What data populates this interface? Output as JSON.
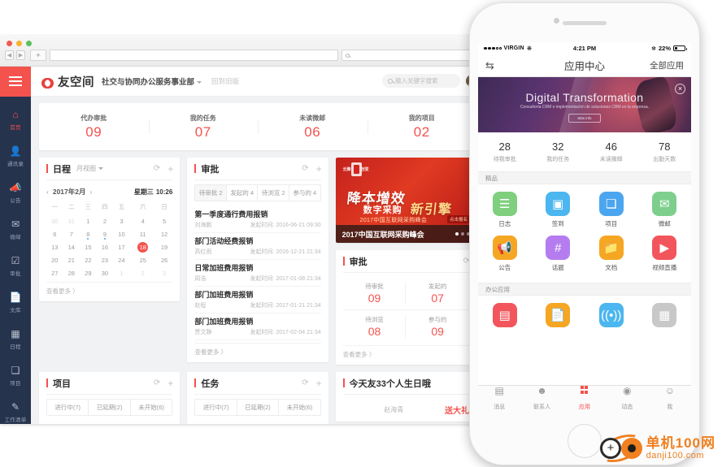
{
  "browser": {
    "tab_new_label": "+",
    "back_icon": "back-arrow-icon",
    "forward_icon": "forward-arrow-icon",
    "url_value": "",
    "search_value": ""
  },
  "app_header": {
    "menu_icon": "hamburger-icon",
    "brand": "友空间",
    "department": "社交与协同办公服务事业部",
    "old_version_link": "回到旧版",
    "search_placeholder": "输入关键字搜索"
  },
  "sidebar": {
    "items": [
      {
        "label": "首页",
        "icon": "home-icon",
        "active": true
      },
      {
        "label": "通讯录",
        "icon": "contacts-icon",
        "active": false
      },
      {
        "label": "公告",
        "icon": "megaphone-icon",
        "active": false
      },
      {
        "label": "微邮",
        "icon": "mail-icon",
        "active": false
      },
      {
        "label": "审批",
        "icon": "check-box-icon",
        "active": false
      },
      {
        "label": "文库",
        "icon": "document-icon",
        "active": false
      },
      {
        "label": "日程",
        "icon": "calendar-icon",
        "active": false
      },
      {
        "label": "项目",
        "icon": "project-icon",
        "active": false
      },
      {
        "label": "工作清单",
        "icon": "edit-list-icon",
        "active": false
      },
      {
        "label": "",
        "icon": "news-icon",
        "active": false
      }
    ]
  },
  "stats": [
    {
      "label": "代办审批",
      "value": "09"
    },
    {
      "label": "我的任务",
      "value": "07"
    },
    {
      "label": "未读微邮",
      "value": "06"
    },
    {
      "label": "我的项目",
      "value": "02"
    }
  ],
  "schedule_panel": {
    "title": "日程",
    "view_mode": "月视图",
    "refresh_icon": "refresh-icon",
    "add_icon": "plus-icon",
    "prev_icon": "‹",
    "next_icon": "›",
    "year_month": "2017年2月",
    "weekday": "星期三",
    "time": "10:26",
    "weekday_headers": [
      "一",
      "二",
      "三",
      "四",
      "五",
      "六",
      "日"
    ],
    "weeks": [
      [
        {
          "d": "30",
          "mute": true
        },
        {
          "d": "31",
          "mute": true
        },
        {
          "d": "1"
        },
        {
          "d": "2"
        },
        {
          "d": "3"
        },
        {
          "d": "4"
        },
        {
          "d": "5"
        }
      ],
      [
        {
          "d": "6"
        },
        {
          "d": "7"
        },
        {
          "d": "8",
          "dot": true
        },
        {
          "d": "9",
          "dot": true
        },
        {
          "d": "10"
        },
        {
          "d": "11"
        },
        {
          "d": "12"
        }
      ],
      [
        {
          "d": "13"
        },
        {
          "d": "14"
        },
        {
          "d": "15"
        },
        {
          "d": "16"
        },
        {
          "d": "17"
        },
        {
          "d": "18",
          "today": true
        },
        {
          "d": "19"
        }
      ],
      [
        {
          "d": "20"
        },
        {
          "d": "21"
        },
        {
          "d": "22"
        },
        {
          "d": "23"
        },
        {
          "d": "24"
        },
        {
          "d": "25"
        },
        {
          "d": "26"
        }
      ],
      [
        {
          "d": "27"
        },
        {
          "d": "28"
        },
        {
          "d": "29"
        },
        {
          "d": "30"
        },
        {
          "d": "1",
          "mute": true
        },
        {
          "d": "2",
          "mute": true
        },
        {
          "d": "3",
          "mute": true
        }
      ]
    ],
    "more": "查看更多 〉"
  },
  "approval_panel": {
    "title": "审批",
    "refresh_icon": "refresh-icon",
    "add_icon": "plus-icon",
    "tabs": [
      {
        "label": "待审批 2",
        "selected": true
      },
      {
        "label": "发起的 4",
        "selected": false
      },
      {
        "label": "待浏览 2",
        "selected": false
      },
      {
        "label": "参与的 4",
        "selected": false
      }
    ],
    "time_prefix": "发起时间:",
    "items": [
      {
        "title": "第一季度通行费用报销",
        "who": "刘海鹏",
        "when": "2016-06-21 09:30"
      },
      {
        "title": "部门活动经费报销",
        "who": "高红雨",
        "when": "2016-12-21 21:34"
      },
      {
        "title": "日常加班费用报销",
        "who": "周浩",
        "when": "2017-01-08 21:34"
      },
      {
        "title": "部门加班费用报销",
        "who": "赵程",
        "when": "2017-01-21 21:34"
      },
      {
        "title": "部门加班费用报销",
        "who": "贾文静",
        "when": "2017-02-04 21:34"
      }
    ],
    "more": "查看更多 〉"
  },
  "banner": {
    "seal_left": "云聚",
    "seal_right": "创变",
    "headline": "降本增效",
    "sub_headline": "数字采购",
    "gold_text": "新引擎",
    "small_text": "2017中国互联网采购峰会",
    "pill": "点击报名",
    "caption": "2017中国互联网采购峰会"
  },
  "approval_summary": {
    "title": "审批",
    "refresh_icon": "refresh-icon",
    "cells": [
      {
        "label": "待审批",
        "value": "09"
      },
      {
        "label": "发起的",
        "value": "07"
      },
      {
        "label": "待浏览",
        "value": "08"
      },
      {
        "label": "参与的",
        "value": "09"
      }
    ],
    "more": "查看更多 〉"
  },
  "bottom_panels": {
    "project": {
      "title": "项目",
      "refresh_icon": "refresh-icon",
      "add_icon": "plus-icon",
      "tabs": [
        "进行中(7)",
        "已延期(2)",
        "未开始(6)"
      ]
    },
    "task": {
      "title": "任务",
      "refresh_icon": "refresh-icon",
      "add_icon": "plus-icon",
      "tabs": [
        "进行中(7)",
        "已延期(2)",
        "未开始(6)"
      ]
    },
    "birthday": {
      "title": "今天友33个人生日哦",
      "name": "赵海青",
      "action": "送大礼"
    }
  },
  "phone": {
    "status_bar": {
      "carrier": "VIRGIN",
      "wifi_icon": "wifi-icon",
      "time": "4:21 PM",
      "bluetooth_icon": "bluetooth-icon",
      "battery_percent": "22%"
    },
    "nav": {
      "left_icon": "switch-account-icon",
      "title": "应用中心",
      "right_label": "全部应用"
    },
    "banner": {
      "title": "Digital Transformation",
      "subtitle": "Consultoría CRM e implementación de soluciones CRM en la empresa.",
      "button": "Más info",
      "close_icon": "close-icon"
    },
    "stats": [
      {
        "value": "28",
        "label": "待我审批"
      },
      {
        "value": "32",
        "label": "我的任务"
      },
      {
        "value": "46",
        "label": "未读微邮"
      },
      {
        "value": "78",
        "label": "出勤天数"
      }
    ],
    "section_featured": "精品",
    "featured_apps": [
      {
        "label": "日志",
        "icon": "journal-icon",
        "glyph": "☰",
        "color": "#7ecf7e"
      },
      {
        "label": "签到",
        "icon": "check-in-calendar-icon",
        "glyph": "▣",
        "color": "#4bb6ef"
      },
      {
        "label": "项目",
        "icon": "project-icon",
        "glyph": "❏",
        "color": "#4ba6ef"
      },
      {
        "label": "微邮",
        "icon": "mail-icon",
        "glyph": "✉",
        "color": "#7ecf8e"
      },
      {
        "label": "公告",
        "icon": "megaphone-icon",
        "glyph": "📢",
        "color": "#f5a623"
      },
      {
        "label": "话题",
        "icon": "hashtag-icon",
        "glyph": "#",
        "color": "#b57cf0"
      },
      {
        "label": "文档",
        "icon": "folder-icon",
        "glyph": "📁",
        "color": "#f5a623"
      },
      {
        "label": "视频直播",
        "icon": "video-live-icon",
        "glyph": "▶",
        "color": "#f2565c"
      }
    ],
    "section_office": "办公应用",
    "office_apps": [
      {
        "label": "",
        "icon": "news-card-icon",
        "glyph": "▤",
        "color": "#f2565c"
      },
      {
        "label": "",
        "icon": "document-icon",
        "glyph": "📄",
        "color": "#f5a623"
      },
      {
        "label": "",
        "icon": "broadcast-icon",
        "glyph": "((•))",
        "color": "#4bb6ef"
      },
      {
        "label": "",
        "icon": "more-apps-icon",
        "glyph": "▦",
        "color": "#c8c8c8"
      }
    ],
    "tabbar": [
      {
        "label": "消息",
        "icon": "message-icon",
        "glyph": "💬",
        "active": false
      },
      {
        "label": "联系人",
        "icon": "contacts-icon",
        "glyph": "👤",
        "active": false
      },
      {
        "label": "应用",
        "icon": "apps-grid-icon",
        "glyph": "▦",
        "active": true
      },
      {
        "label": "动态",
        "icon": "activity-icon",
        "glyph": "◠",
        "active": false
      },
      {
        "label": "我",
        "icon": "profile-icon",
        "glyph": "👤",
        "active": false
      }
    ]
  },
  "watermark": {
    "name": "单机100网",
    "url": "danji100.com"
  },
  "colors": {
    "accent_red": "#f4524d",
    "sidebar_bg": "#26334d"
  }
}
